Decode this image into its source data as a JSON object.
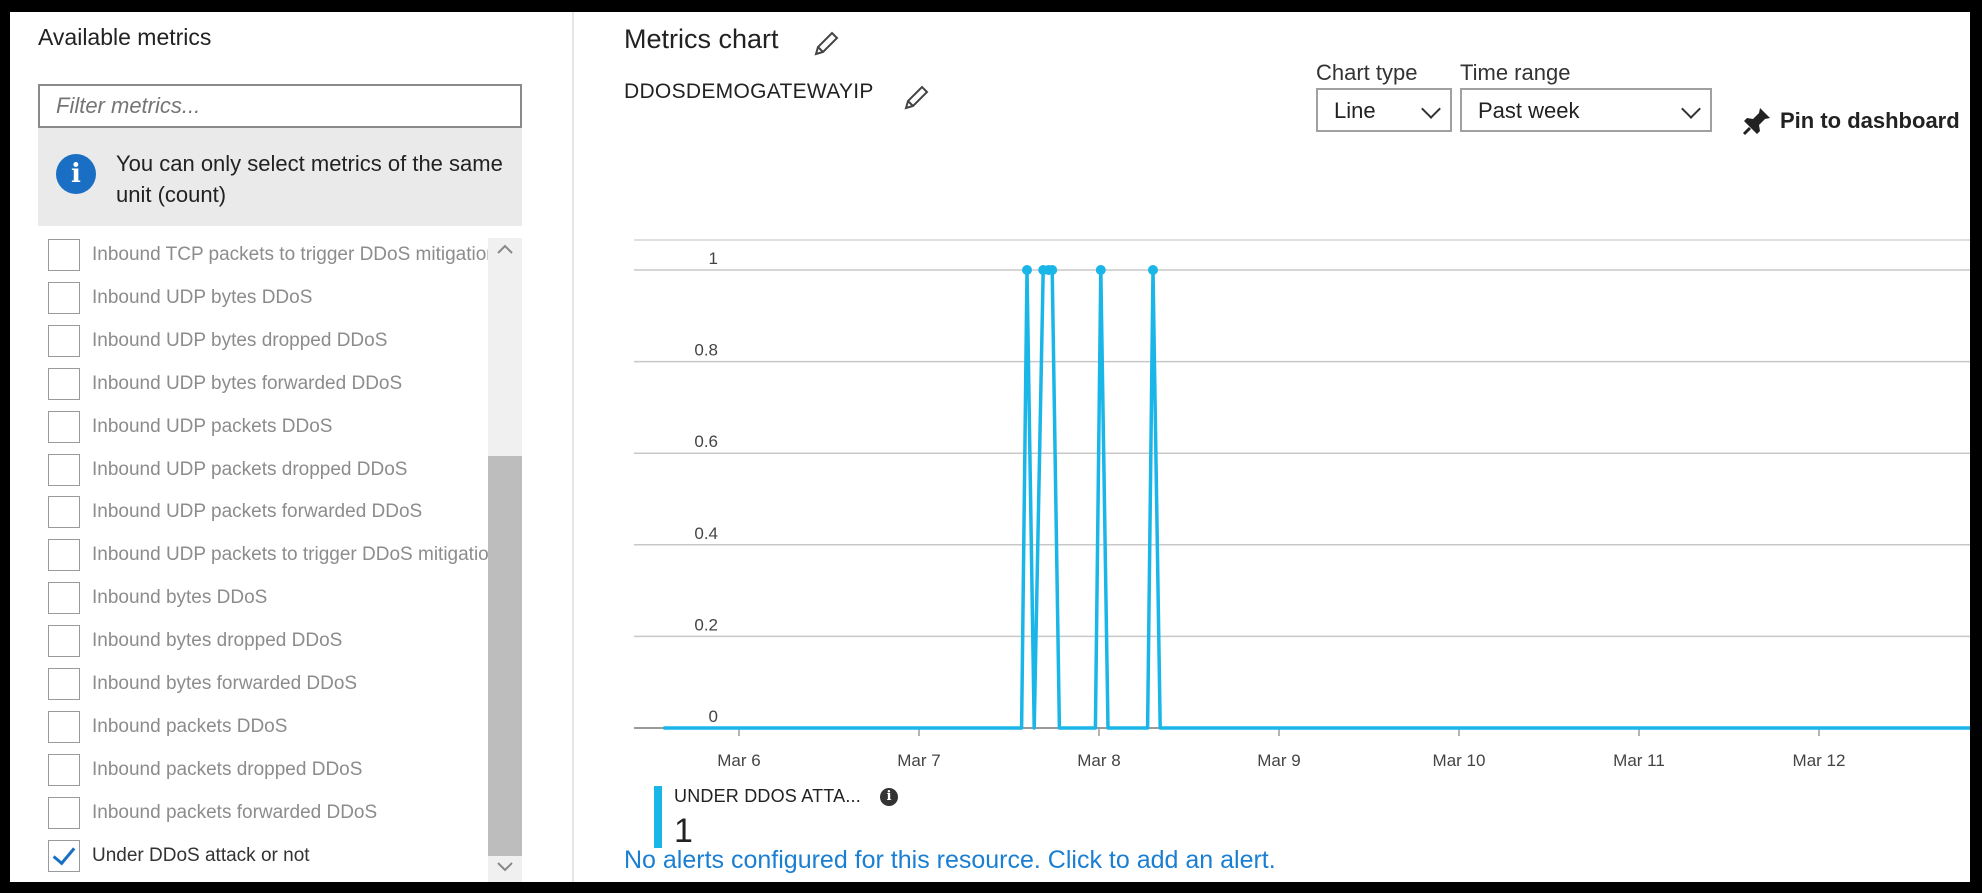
{
  "left_panel": {
    "title": "Available metrics",
    "filter_placeholder": "Filter metrics...",
    "info_text": "You can only select metrics of the same unit (count)",
    "metrics": [
      {
        "label": "Inbound TCP packets to trigger DDoS mitigation",
        "checked": false
      },
      {
        "label": "Inbound UDP bytes DDoS",
        "checked": false
      },
      {
        "label": "Inbound UDP bytes dropped DDoS",
        "checked": false
      },
      {
        "label": "Inbound UDP bytes forwarded DDoS",
        "checked": false
      },
      {
        "label": "Inbound UDP packets DDoS",
        "checked": false
      },
      {
        "label": "Inbound UDP packets dropped DDoS",
        "checked": false
      },
      {
        "label": "Inbound UDP packets forwarded DDoS",
        "checked": false
      },
      {
        "label": "Inbound UDP packets to trigger DDoS mitigation",
        "checked": false
      },
      {
        "label": "Inbound bytes DDoS",
        "checked": false
      },
      {
        "label": "Inbound bytes dropped DDoS",
        "checked": false
      },
      {
        "label": "Inbound bytes forwarded DDoS",
        "checked": false
      },
      {
        "label": "Inbound packets DDoS",
        "checked": false
      },
      {
        "label": "Inbound packets dropped DDoS",
        "checked": false
      },
      {
        "label": "Inbound packets forwarded DDoS",
        "checked": false
      },
      {
        "label": "Under DDoS attack or not",
        "checked": true
      }
    ]
  },
  "right_panel": {
    "title": "Metrics chart",
    "resource_name": "DDOSDEMOGATEWAYIP",
    "chart_type_label": "Chart type",
    "chart_type_value": "Line",
    "time_range_label": "Time range",
    "time_range_value": "Past week",
    "pin_label": "Pin to dashboard",
    "legend": {
      "name": "UNDER DDOS ATTA...",
      "value": "1"
    },
    "alert_text": "No alerts configured for this resource. Click to add an alert."
  },
  "colors": {
    "series": "#1ab6e8",
    "link": "#1a7fd2",
    "info": "#1a6fc4"
  },
  "chart_data": {
    "type": "line",
    "y_ticks": [
      "0",
      "0.2",
      "0.4",
      "0.6",
      "0.8",
      "1"
    ],
    "x_ticks": [
      "Mar 6",
      "Mar 7",
      "Mar 8",
      "Mar 9",
      "Mar 10",
      "Mar 11",
      "Mar 12"
    ],
    "ylim": [
      0,
      1
    ],
    "xlim": [
      5.58,
      13.47
    ],
    "grid": true,
    "series": [
      {
        "x": [
          5.58,
          7.57,
          7.6,
          7.64,
          7.69,
          7.72,
          7.74,
          7.78,
          7.98,
          8.01,
          8.05,
          8.27,
          8.3,
          8.34,
          13.47
        ],
        "values": [
          0,
          0,
          1,
          0,
          1,
          1,
          1,
          0,
          0,
          1,
          0,
          0,
          1,
          0,
          0
        ]
      }
    ]
  }
}
